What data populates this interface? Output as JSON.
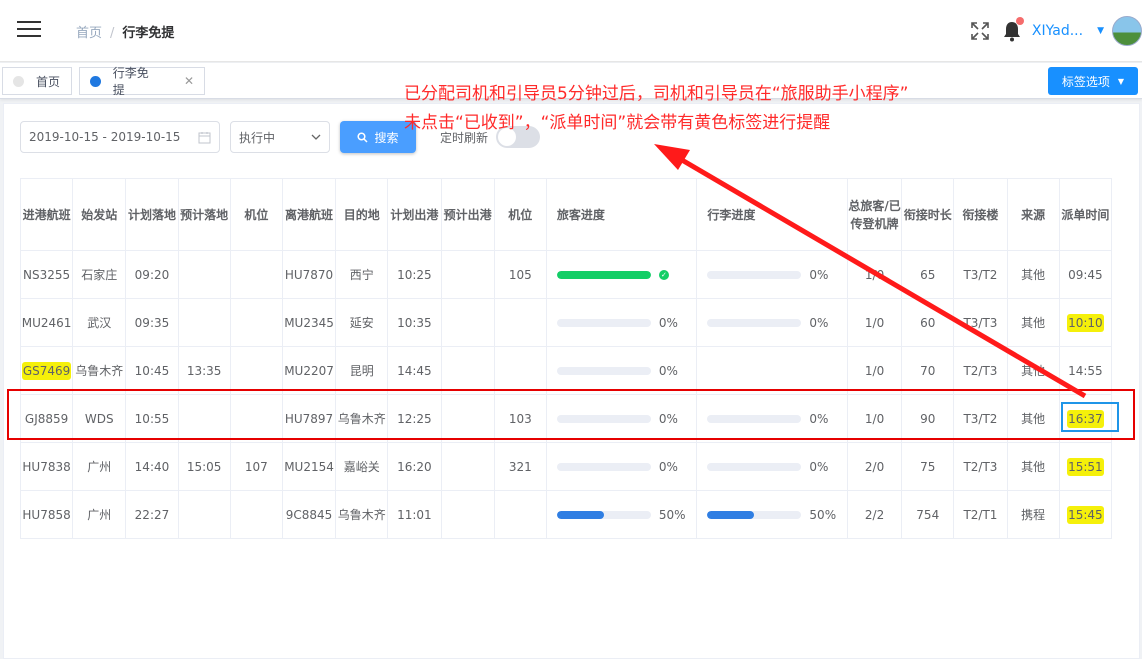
{
  "header": {
    "breadcrumb": [
      "首页",
      "行李免提"
    ],
    "username": "XIYad...",
    "icons": [
      "hamburger-icon",
      "fullscreen-icon",
      "bell-icon",
      "avatar"
    ]
  },
  "tags": {
    "items": [
      {
        "label": "首页",
        "active": false
      },
      {
        "label": "行李免提",
        "active": true
      }
    ],
    "options_label": "标签选项"
  },
  "filters": {
    "date_range": "2019-10-15 - 2019-10-15",
    "status": "执行中",
    "search_label": "搜索",
    "refresh_label": "定时刷新"
  },
  "annotation": {
    "line1": "已分配司机和引导员5分钟过后，司机和引导员在“旅服助手小程序”",
    "line2": "未点击“已收到”，“派单时间”就会带有黄色标签进行提醒"
  },
  "table": {
    "headers": [
      "进港航班",
      "始发站",
      "计划落地",
      "预计落地",
      "机位",
      "离港航班",
      "目的地",
      "计划出港",
      "预计出港",
      "机位",
      "旅客进度",
      "行李进度",
      "总旅客/已传登机牌",
      "衔接时长",
      "衔接楼",
      "来源",
      "派单时间"
    ],
    "rows": [
      {
        "in_flight": "NS3255",
        "origin": "石家庄",
        "plan_land": "09:20",
        "est_land": "",
        "stand_in": "",
        "out_flight": "HU7870",
        "dest": "西宁",
        "plan_dep": "10:25",
        "est_dep": "",
        "stand_out": "105",
        "pax_pct": 100,
        "pax_label": "",
        "pax_done": true,
        "bag_pct": 0,
        "bag_label": "0%",
        "count": "1/0",
        "conn": "65",
        "term": "T3/T2",
        "src": "其他",
        "dispatch": "09:45",
        "hl_flight": false,
        "hl_dispatch": false
      },
      {
        "in_flight": "MU2461",
        "origin": "武汉",
        "plan_land": "09:35",
        "est_land": "",
        "stand_in": "",
        "out_flight": "MU2345",
        "dest": "延安",
        "plan_dep": "10:35",
        "est_dep": "",
        "stand_out": "",
        "pax_pct": 0,
        "pax_label": "0%",
        "pax_done": false,
        "bag_pct": 0,
        "bag_label": "0%",
        "count": "1/0",
        "conn": "60",
        "term": "T3/T3",
        "src": "其他",
        "dispatch": "10:10",
        "hl_flight": false,
        "hl_dispatch": true
      },
      {
        "in_flight": "GS7469",
        "origin": "乌鲁木齐",
        "plan_land": "10:45",
        "est_land": "13:35",
        "stand_in": "",
        "out_flight": "MU2207",
        "dest": "昆明",
        "plan_dep": "14:45",
        "est_dep": "",
        "stand_out": "",
        "pax_pct": 0,
        "pax_label": "0%",
        "pax_done": false,
        "bag_pct": null,
        "bag_label": "",
        "count": "1/0",
        "conn": "70",
        "term": "T2/T3",
        "src": "其他",
        "dispatch": "14:55",
        "hl_flight": true,
        "hl_dispatch": false
      },
      {
        "in_flight": "GJ8859",
        "origin": "WDS",
        "plan_land": "10:55",
        "est_land": "",
        "stand_in": "",
        "out_flight": "HU7897",
        "dest": "乌鲁木齐",
        "plan_dep": "12:25",
        "est_dep": "",
        "stand_out": "103",
        "pax_pct": 0,
        "pax_label": "0%",
        "pax_done": false,
        "bag_pct": 0,
        "bag_label": "0%",
        "count": "1/0",
        "conn": "90",
        "term": "T3/T2",
        "src": "其他",
        "dispatch": "16:37",
        "hl_flight": false,
        "hl_dispatch": true
      },
      {
        "in_flight": "HU7838",
        "origin": "广州",
        "plan_land": "14:40",
        "est_land": "15:05",
        "stand_in": "107",
        "out_flight": "MU2154",
        "dest": "嘉峪关",
        "plan_dep": "16:20",
        "est_dep": "",
        "stand_out": "321",
        "pax_pct": 0,
        "pax_label": "0%",
        "pax_done": false,
        "bag_pct": 0,
        "bag_label": "0%",
        "count": "2/0",
        "conn": "75",
        "term": "T2/T3",
        "src": "其他",
        "dispatch": "15:51",
        "hl_flight": false,
        "hl_dispatch": true
      },
      {
        "in_flight": "HU7858",
        "origin": "广州",
        "plan_land": "22:27",
        "est_land": "",
        "stand_in": "",
        "out_flight": "9C8845",
        "dest": "乌鲁木齐",
        "plan_dep": "11:01",
        "est_dep": "",
        "stand_out": "",
        "pax_pct": 50,
        "pax_label": "50%",
        "pax_done": false,
        "bag_pct": 50,
        "bag_label": "50%",
        "count": "2/2",
        "conn": "754",
        "term": "T2/T1",
        "src": "携程",
        "dispatch": "15:45",
        "hl_flight": false,
        "hl_dispatch": true
      }
    ]
  },
  "colors": {
    "primary": "#1890ff",
    "success": "#13ce66",
    "progress_blue": "#2f7ee3",
    "highlight": "#f5f00a",
    "annotation_red": "#ff2a2a"
  }
}
